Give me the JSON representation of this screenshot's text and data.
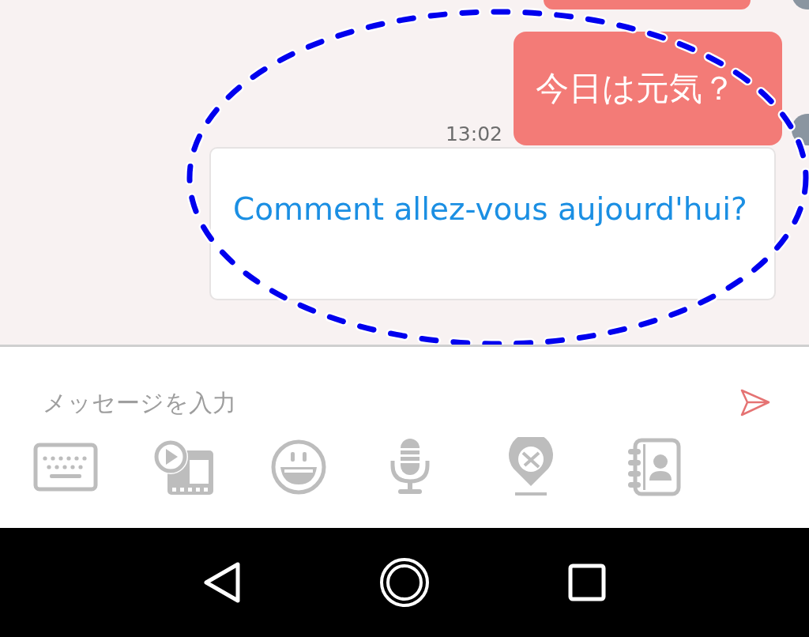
{
  "messages": [
    {
      "kind": "sent_partial"
    },
    {
      "kind": "sent",
      "text": "今日は元気？",
      "time": "13:02"
    },
    {
      "kind": "translation",
      "text": "Comment allez-vous aujourd'hui?"
    }
  ],
  "highlight": {
    "kind": "dashed_ellipse"
  },
  "input": {
    "placeholder": "メッセージを入力"
  },
  "toolbar": [
    {
      "kind": "keyboard"
    },
    {
      "kind": "media"
    },
    {
      "kind": "emoji"
    },
    {
      "kind": "microphone"
    },
    {
      "kind": "location"
    },
    {
      "kind": "contacts"
    }
  ],
  "nav": [
    {
      "kind": "back"
    },
    {
      "kind": "home"
    },
    {
      "kind": "recents"
    }
  ]
}
